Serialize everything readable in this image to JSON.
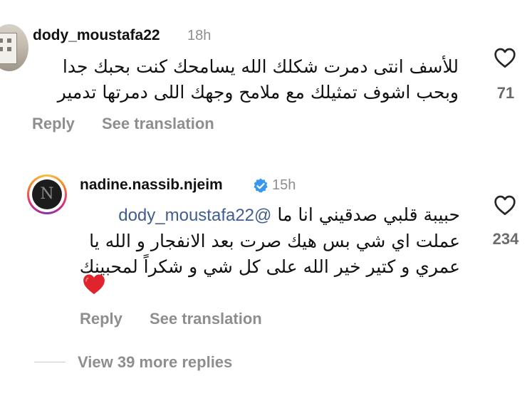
{
  "comments": [
    {
      "username": "dody_moustafa22",
      "time": "18h",
      "text_lines": [
        "للأسف انتى دمرت شكلك الله يسامحك كنت بحبك جدا",
        "وبحب اشوف تمثيلك مع ملامح وجهك اللى دمرتها تدمير"
      ],
      "likes": "71",
      "reply_label": "Reply",
      "translate_label": "See translation",
      "avatar_icon": "profile-photo-building"
    },
    {
      "username": "nadine.nassib.njeim",
      "verified": true,
      "time": "15h",
      "mention": "@dody_moustafa22",
      "text_line1": "حبيبة قلبي صدقيني انا ما",
      "text_lines": [
        "عملت اي شي بس هيك صرت بعد الانفجار و الله يا",
        "عمري و كتير خير الله على كل شي و شكراً لمحبينك"
      ],
      "emoji": "❤️",
      "likes": "234",
      "reply_label": "Reply",
      "translate_label": "See translation",
      "avatar_icon": "profile-photo-monogram"
    }
  ],
  "view_more_replies": "View 39 more replies",
  "colors": {
    "text": "#111111",
    "secondary": "#8e8e8e",
    "mention": "#3f5e8f",
    "verified": "#3897f0",
    "heart_emoji": "#e0242e"
  },
  "icons": {
    "like": "heart-outline-icon",
    "verified": "verified-badge-icon"
  }
}
